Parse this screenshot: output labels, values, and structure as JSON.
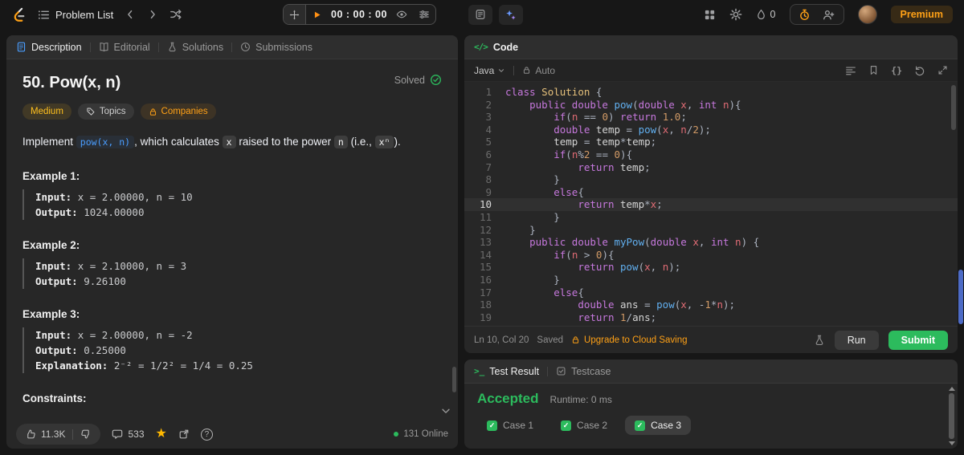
{
  "topbar": {
    "problem_list_label": "Problem List",
    "timer_value": "00 : 00 : 00",
    "streak_count": "0",
    "premium_label": "Premium"
  },
  "description": {
    "tabs": [
      {
        "label": "Description"
      },
      {
        "label": "Editorial"
      },
      {
        "label": "Solutions"
      },
      {
        "label": "Submissions"
      }
    ],
    "title": "50. Pow(x, n)",
    "solved_label": "Solved",
    "difficulty": "Medium",
    "topics_label": "Topics",
    "companies_label": "Companies",
    "statement": {
      "prefix": "Implement ",
      "link": "pow(x, n)",
      "mid1": ", which calculates ",
      "code1": "x",
      "mid2": " raised to the power ",
      "code2": "n",
      "mid3": " (i.e., ",
      "code3": "xⁿ",
      "suffix": ")."
    },
    "examples": [
      {
        "label": "Example 1:",
        "input_label": "Input:",
        "input": "x = 2.00000, n = 10",
        "output_label": "Output:",
        "output": "1024.00000"
      },
      {
        "label": "Example 2:",
        "input_label": "Input:",
        "input": "x = 2.10000, n = 3",
        "output_label": "Output:",
        "output": "9.26100"
      },
      {
        "label": "Example 3:",
        "input_label": "Input:",
        "input": "x = 2.00000, n = -2",
        "output_label": "Output:",
        "output": "0.25000",
        "explanation_label": "Explanation:",
        "explanation": "2⁻² = 1/2² = 1/4 = 0.25"
      }
    ],
    "constraints_label": "Constraints:",
    "footer": {
      "likes": "11.3K",
      "comments": "533",
      "online": "131 Online"
    }
  },
  "code": {
    "header_label": "Code",
    "language": "Java",
    "auto_label": "Auto",
    "active_line": 10,
    "lines": [
      "class Solution {",
      "    public double pow(double x, int n){",
      "        if(n == 0) return 1.0;",
      "        double temp = pow(x, n/2);",
      "        temp = temp*temp;",
      "        if(n%2 == 0){",
      "            return temp;",
      "        }",
      "        else{",
      "            return temp*x;",
      "        }",
      "    }",
      "    public double myPow(double x, int n) {",
      "        if(n > 0){",
      "            return pow(x, n);",
      "        }",
      "        else{",
      "            double ans = pow(x, -1*n);",
      "            return 1/ans;"
    ],
    "footer": {
      "position": "Ln 10, Col 20",
      "saved": "Saved",
      "cloud": "Upgrade to Cloud Saving",
      "run_label": "Run",
      "submit_label": "Submit"
    }
  },
  "result": {
    "tabs": [
      {
        "label": "Test Result"
      },
      {
        "label": "Testcase"
      }
    ],
    "status": "Accepted",
    "runtime": "Runtime: 0 ms",
    "cases": [
      {
        "label": "Case 1",
        "active": false
      },
      {
        "label": "Case 2",
        "active": false
      },
      {
        "label": "Case 3",
        "active": true
      }
    ]
  },
  "colors": {
    "brand_orange": "#ffa116",
    "success_green": "#2cbb5d",
    "link_blue": "#4a9eff",
    "medium_yellow": "#ffc01e"
  }
}
